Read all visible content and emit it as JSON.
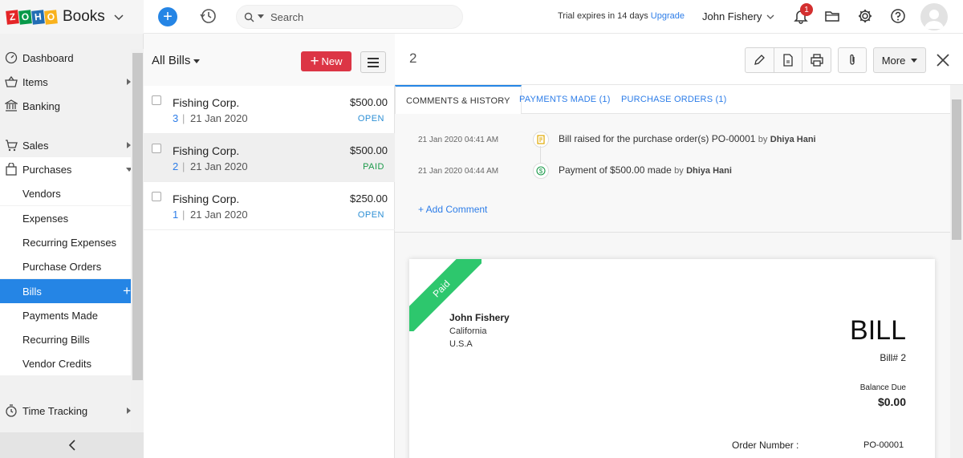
{
  "app": {
    "logo_letters": [
      "Z",
      "O",
      "H",
      "O"
    ],
    "name": "Books"
  },
  "topbar": {
    "search_placeholder": "Search",
    "trial_text": "Trial expires in 14 days",
    "upgrade_label": "Upgrade",
    "user_name": "John Fishery",
    "notification_count": "1"
  },
  "sidebar": {
    "items": [
      {
        "label": "Dashboard",
        "icon": "dashboard-icon"
      },
      {
        "label": "Items",
        "icon": "basket-icon"
      },
      {
        "label": "Banking",
        "icon": "bank-icon"
      },
      {
        "label": "Sales",
        "icon": "cart-icon"
      },
      {
        "label": "Purchases",
        "icon": "bag-icon"
      },
      {
        "label": "Time Tracking",
        "icon": "clock-icon"
      }
    ],
    "purchases_sub": [
      "Vendors",
      "Expenses",
      "Recurring Expenses",
      "Purchase Orders",
      "Bills",
      "Payments Made",
      "Recurring Bills",
      "Vendor Credits"
    ],
    "active_item": "Bills"
  },
  "list": {
    "view_label": "All Bills",
    "new_label": "New",
    "rows": [
      {
        "vendor": "Fishing Corp.",
        "number": "3",
        "date": "21 Jan 2020",
        "amount": "$500.00",
        "status": "OPEN"
      },
      {
        "vendor": "Fishing Corp.",
        "number": "2",
        "date": "21 Jan 2020",
        "amount": "$500.00",
        "status": "PAID"
      },
      {
        "vendor": "Fishing Corp.",
        "number": "1",
        "date": "21 Jan 2020",
        "amount": "$250.00",
        "status": "OPEN"
      }
    ]
  },
  "detail": {
    "bill_number": "2",
    "more_label": "More",
    "tabs": [
      "COMMENTS & HISTORY",
      "PAYMENTS MADE (1)",
      "PURCHASE ORDERS (1)"
    ],
    "history": [
      {
        "time": "21 Jan 2020 04:41 AM",
        "text": "Bill raised for the purchase order(s) PO-00001",
        "by": "by",
        "who": "Dhiya Hani"
      },
      {
        "time": "21 Jan 2020 04:44 AM",
        "text": "Payment of $500.00 made",
        "by": "by",
        "who": "Dhiya Hani"
      }
    ],
    "add_comment": "+ Add Comment",
    "document": {
      "ribbon": "Paid",
      "from_name": "John Fishery",
      "from_line1": "California",
      "from_line2": "U.S.A",
      "title": "BILL",
      "bill_no_text": "Bill# 2",
      "balance_label": "Balance Due",
      "balance_value": "$0.00",
      "order_label": "Order Number :",
      "order_value": "PO-00001"
    }
  },
  "colors": {
    "accent": "#2585e5",
    "new_button": "#dc3545",
    "paid_ribbon": "#2dc76d",
    "open_status": "#2d8fd5",
    "paid_status": "#1b9a4a"
  }
}
